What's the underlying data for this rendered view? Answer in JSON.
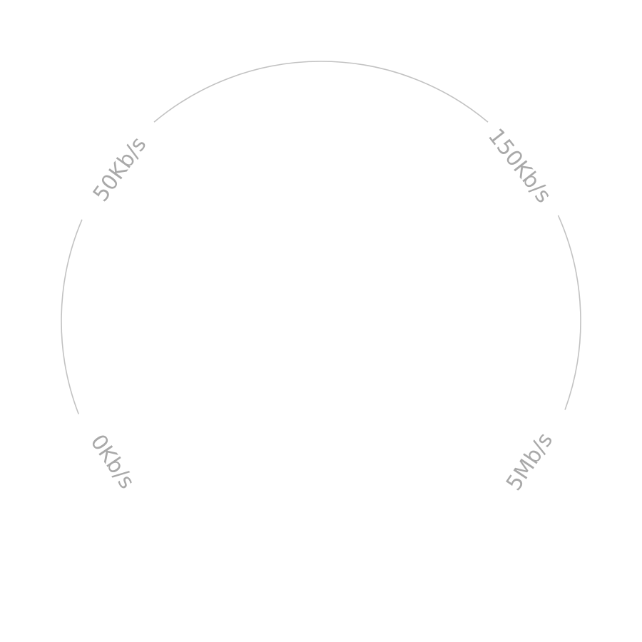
{
  "gauge": {
    "ticks": [
      {
        "label": "0Kb/s"
      },
      {
        "label": "50Kb/s"
      },
      {
        "label": "150Kb/s"
      },
      {
        "label": "5Mb/s"
      }
    ],
    "arc_color": "#c2c2c2",
    "label_color": "#a9a9a9"
  }
}
